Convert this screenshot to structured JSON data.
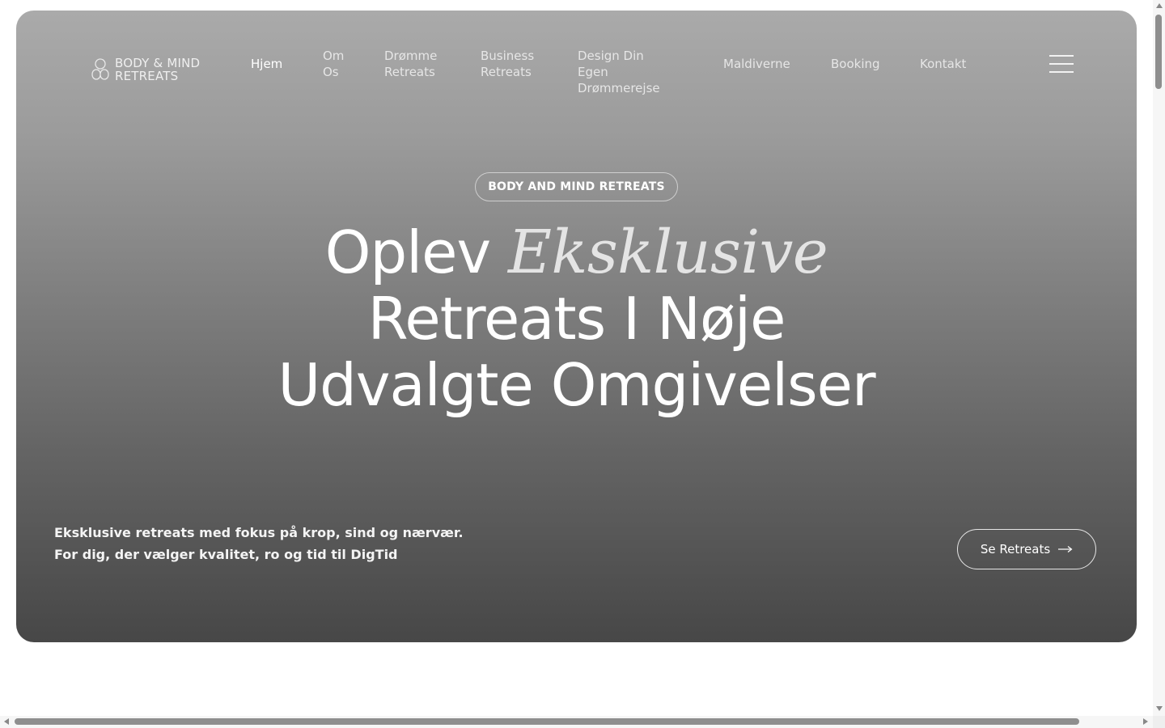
{
  "logo": {
    "line1": "BODY & MIND",
    "line2": "RETREATS"
  },
  "nav": {
    "items": [
      {
        "label": "Hjem",
        "active": true
      },
      {
        "label": "Om\nOs",
        "active": false
      },
      {
        "label": "Drømme\nRetreats",
        "active": false
      },
      {
        "label": "Business\nRetreats",
        "active": false
      },
      {
        "label": "Design Din Egen\nDrømmerejse",
        "active": false
      },
      {
        "label": "Maldiverne",
        "active": false
      },
      {
        "label": "Booking",
        "active": false
      },
      {
        "label": "Kontakt",
        "active": false
      }
    ],
    "menu_icon": "hamburger-menu-icon"
  },
  "hero": {
    "tag": "BODY AND MIND RETREATS",
    "headline_word1": "Oplev",
    "headline_em": "Eksklusive",
    "headline_line2": "Retreats I Nøje",
    "headline_line3": "Udvalgte Omgivelser",
    "subtext_line1": "Eksklusive retreats med fokus på krop, sind og nærvær.",
    "subtext_line2": "For dig, der vælger kvalitet, ro og tid til DigTid",
    "cta_label": "Se Retreats",
    "cta_icon": "arrow-right-icon"
  },
  "colors": {
    "text": "#ffffff",
    "hero_top": "#aaaaaa",
    "hero_bottom": "#474747"
  }
}
